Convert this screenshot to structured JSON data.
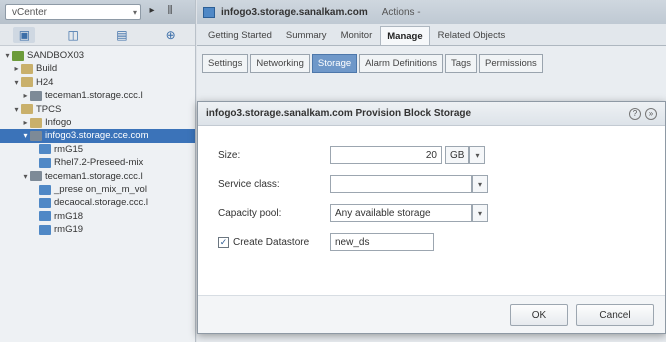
{
  "navigator": {
    "vcenter_select": "vCenter",
    "tree": [
      {
        "label": "SANDBOX03",
        "indent": 0,
        "twisty": "▾",
        "icon": "dc"
      },
      {
        "label": "Build",
        "indent": 1,
        "twisty": "▸",
        "icon": "folder"
      },
      {
        "label": "H24",
        "indent": 1,
        "twisty": "▾",
        "icon": "folder"
      },
      {
        "label": "teceman1.storage.ccc.l",
        "indent": 2,
        "twisty": "▸",
        "icon": "host"
      },
      {
        "label": "TPCS",
        "indent": 1,
        "twisty": "▾",
        "icon": "folder"
      },
      {
        "label": "Infogo",
        "indent": 2,
        "twisty": "▸",
        "icon": "folder"
      },
      {
        "label": "infogo3.storage.cce.com",
        "indent": 2,
        "twisty": "▾",
        "icon": "host",
        "selected": true
      },
      {
        "label": "rmG15",
        "indent": 3,
        "twisty": "",
        "icon": "vm"
      },
      {
        "label": "Rhel7.2-Preseed-mix",
        "indent": 3,
        "twisty": "",
        "icon": "vm"
      },
      {
        "label": "teceman1.storage.ccc.l",
        "indent": 2,
        "twisty": "▾",
        "icon": "host"
      },
      {
        "label": "_prese on_mix_m_vol",
        "indent": 3,
        "twisty": "",
        "icon": "vm"
      },
      {
        "label": "decaocal.storage.ccc.l",
        "indent": 3,
        "twisty": "",
        "icon": "vm"
      },
      {
        "label": "rmG18",
        "indent": 3,
        "twisty": "",
        "icon": "vm"
      },
      {
        "label": "rmG19",
        "indent": 3,
        "twisty": "",
        "icon": "vm"
      }
    ]
  },
  "object_bar": {
    "name": "infogo3.storage.sanalkam.com",
    "actions": "Actions -"
  },
  "tabs": [
    "Getting Started",
    "Summary",
    "Monitor",
    "Manage",
    "Related Objects"
  ],
  "active_tab": "Manage",
  "subtabs": [
    "Settings",
    "Networking",
    "Storage",
    "Alarm Definitions",
    "Tags",
    "Permissions"
  ],
  "active_subtab": "Storage",
  "dialog": {
    "title": "infogo3.storage.sanalkam.com Provision Block Storage",
    "size_label": "Size:",
    "size_value": "20",
    "size_unit": "GB",
    "service_class_label": "Service class:",
    "service_class_value": "",
    "capacity_pool_label": "Capacity pool:",
    "capacity_pool_value": "Any available storage",
    "create_datastore_label": "Create Datastore",
    "create_datastore_checked": true,
    "datastore_name": "new_ds",
    "ok_label": "OK",
    "cancel_label": "Cancel"
  }
}
